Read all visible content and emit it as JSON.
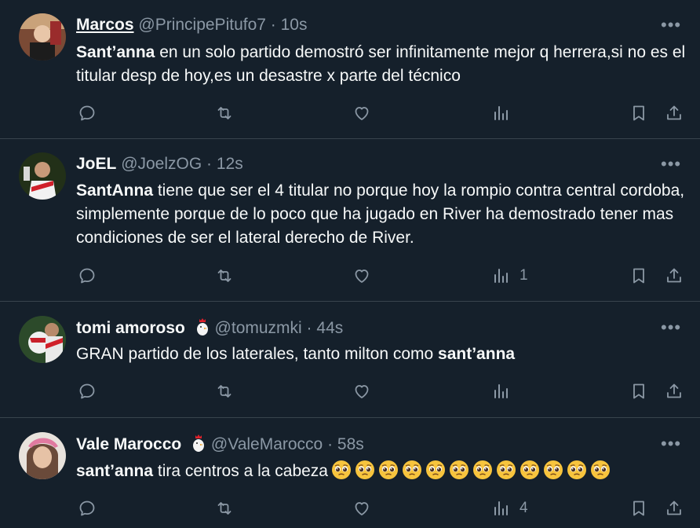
{
  "tweets": [
    {
      "name": "Marcos",
      "handle": "@PrincipePitufo7",
      "time": "10s",
      "text_bold": "Sant’anna",
      "text_rest": " en un solo partido demostró ser infinitamente mejor q herrera,si no es el titular desp de hoy,es un desastre x parte del técnico",
      "views": ""
    },
    {
      "name": "JoEL",
      "handle": "@JoelzOG",
      "time": "12s",
      "text_bold": "SantAnna",
      "text_rest": " tiene que ser el 4 titular no porque hoy la rompio contra central cordoba, simplemente porque de lo poco que ha jugado en River ha demostrado tener mas condiciones de ser el lateral derecho de River.",
      "views": "1"
    },
    {
      "name": "tomi amoroso",
      "handle": "@tomuzmki",
      "time": "44s",
      "text_pre": "GRAN partido de los laterales, tanto milton como ",
      "text_bold": "sant’anna",
      "views": ""
    },
    {
      "name": "Vale Marocco",
      "handle": "@ValeMarocco",
      "time": "58s",
      "text_bold": "sant’anna",
      "text_rest": " tira centros a la cabeza",
      "emoji_count": 12,
      "views": "4"
    }
  ],
  "sep": " · ",
  "more_label": "•••",
  "icons": [
    "reply-icon",
    "retweet-icon",
    "like-icon",
    "views-icon",
    "bookmark-icon",
    "share-icon"
  ],
  "colors": {
    "bg": "#15202b",
    "text": "#f7f9f9",
    "muted": "#8b98a5",
    "divider": "#38444d"
  }
}
